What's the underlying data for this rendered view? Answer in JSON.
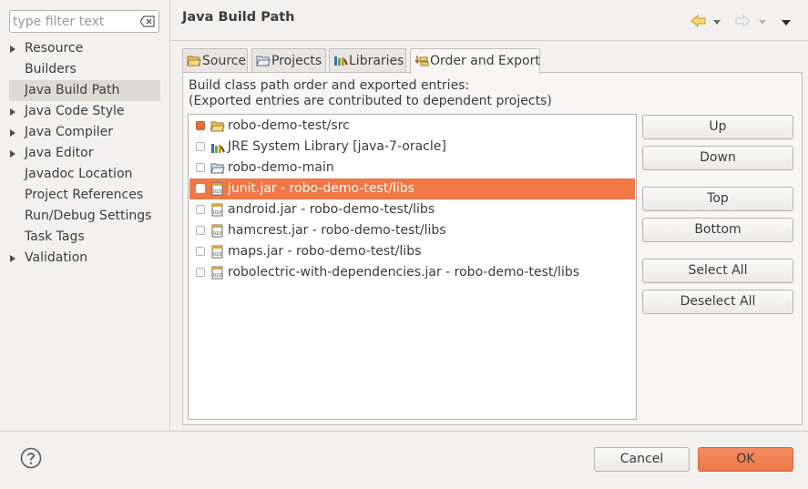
{
  "filter": {
    "placeholder": "type filter text"
  },
  "sidebar": {
    "items": [
      {
        "label": "Resource",
        "expandable": true
      },
      {
        "label": "Builders",
        "expandable": false
      },
      {
        "label": "Java Build Path",
        "expandable": false,
        "selected": true
      },
      {
        "label": "Java Code Style",
        "expandable": true
      },
      {
        "label": "Java Compiler",
        "expandable": true
      },
      {
        "label": "Java Editor",
        "expandable": true
      },
      {
        "label": "Javadoc Location",
        "expandable": false
      },
      {
        "label": "Project References",
        "expandable": false
      },
      {
        "label": "Run/Debug Settings",
        "expandable": false
      },
      {
        "label": "Task Tags",
        "expandable": false
      },
      {
        "label": "Validation",
        "expandable": true
      }
    ]
  },
  "header": {
    "title": "Java Build Path"
  },
  "tabs": [
    {
      "label": "Source",
      "icon": "source-folder-icon"
    },
    {
      "label": "Projects",
      "icon": "projects-folder-icon"
    },
    {
      "label": "Libraries",
      "icon": "libraries-icon"
    },
    {
      "label": "Order and Export",
      "icon": "order-export-icon",
      "active": true
    }
  ],
  "order_export": {
    "description_line1": "Build class path order and exported entries:",
    "description_line2": "(Exported entries are contributed to dependent projects)",
    "entries": [
      {
        "label": "robo-demo-test/src",
        "icon": "source-folder-icon",
        "checked": true,
        "selected": false
      },
      {
        "label": "JRE System Library [java-7-oracle]",
        "icon": "library-icon",
        "checked": false,
        "selected": false
      },
      {
        "label": "robo-demo-main",
        "icon": "project-folder-icon",
        "checked": false,
        "selected": false
      },
      {
        "label": "junit.jar - robo-demo-test/libs",
        "icon": "jar-icon",
        "checked": false,
        "selected": true
      },
      {
        "label": "android.jar - robo-demo-test/libs",
        "icon": "jar-icon",
        "checked": false,
        "selected": false
      },
      {
        "label": "hamcrest.jar - robo-demo-test/libs",
        "icon": "jar-icon",
        "checked": false,
        "selected": false
      },
      {
        "label": "maps.jar - robo-demo-test/libs",
        "icon": "jar-icon",
        "checked": false,
        "selected": false
      },
      {
        "label": "robolectric-with-dependencies.jar - robo-demo-test/libs",
        "icon": "jar-icon",
        "checked": false,
        "selected": false
      }
    ],
    "buttons": {
      "up": "Up",
      "down": "Down",
      "top": "Top",
      "bottom": "Bottom",
      "select_all": "Select All",
      "deselect_all": "Deselect All"
    }
  },
  "dialog": {
    "cancel": "Cancel",
    "ok": "OK"
  },
  "colors": {
    "accent": "#f07746",
    "ok_button": "#ef7f50",
    "background": "#f2f1f0"
  }
}
